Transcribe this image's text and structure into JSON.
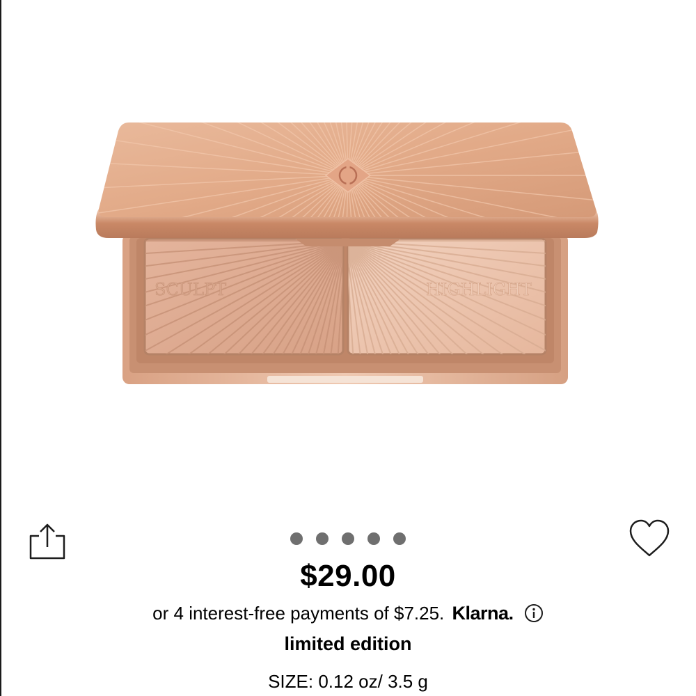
{
  "product": {
    "image_alt": "Sculpt and Highlight palette",
    "pan_labels": [
      "SCULPT",
      "HIGHLIGHT"
    ],
    "price": "$29.00",
    "payments_text": "or 4 interest-free payments of $7.25.",
    "klarna_label": "Klarna.",
    "edition": "limited edition",
    "size": "SIZE: 0.12 oz/ 3.5 g"
  },
  "carousel": {
    "dot_count": 5
  },
  "icons": {
    "share": "share-icon",
    "favorite": "heart-icon",
    "info": "info-icon"
  },
  "colors": {
    "compact_gold": "#d9a07e",
    "dot": "#6f6f6f"
  }
}
